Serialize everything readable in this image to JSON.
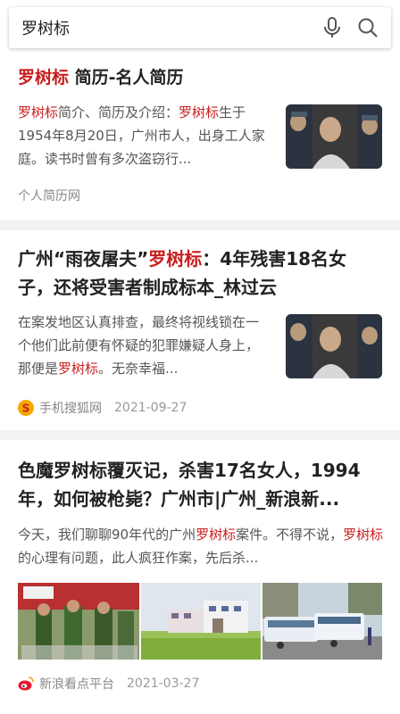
{
  "search": {
    "query": "罗树标"
  },
  "result1": {
    "title_hl": "罗树标",
    "title_rest": " 简历-名人简历",
    "snippet": [
      {
        "t": "罗树标",
        "h": true
      },
      {
        "t": "简介、简历及介绍：",
        "h": false
      },
      {
        "t": "罗树标",
        "h": true
      },
      {
        "t": "生于1954年8月20日，广州市人，出身工人家庭。读书时曾有多次盗窃行...",
        "h": false
      }
    ],
    "source": "个人简历网"
  },
  "result2": {
    "title": [
      {
        "t": "广州“雨夜屠夫”",
        "h": false
      },
      {
        "t": "罗树标",
        "h": true
      },
      {
        "t": "：4年残害18名女子，还将受害者制成标本_林过云",
        "h": false
      }
    ],
    "snippet": [
      {
        "t": "在案发地区认真排查，最终将视线锁在一个他们此前便有怀疑的犯罪嫌疑人身上，那便是",
        "h": false
      },
      {
        "t": "罗树标",
        "h": true
      },
      {
        "t": "。无奈幸福...",
        "h": false
      }
    ],
    "source": "手机搜狐网",
    "date": "2021-09-27"
  },
  "result3": {
    "title": "色魔罗树标覆灭记，杀害17名女人，1994年，如何被枪毙？广州市|广州_新浪新...",
    "snippet": [
      {
        "t": "今天，我们聊聊90年代的广州",
        "h": false
      },
      {
        "t": "罗树标",
        "h": true
      },
      {
        "t": "案件。不得不说，",
        "h": false
      },
      {
        "t": "罗树标",
        "h": true
      },
      {
        "t": "的心理有问题，此人疯狂作案，先后杀...",
        "h": false
      }
    ],
    "source": "新浪看点平台",
    "date": "2021-03-27"
  },
  "colors": {
    "highlight": "#c91d1d",
    "sohu": "#f5a800",
    "weibo": "#e6162d"
  }
}
